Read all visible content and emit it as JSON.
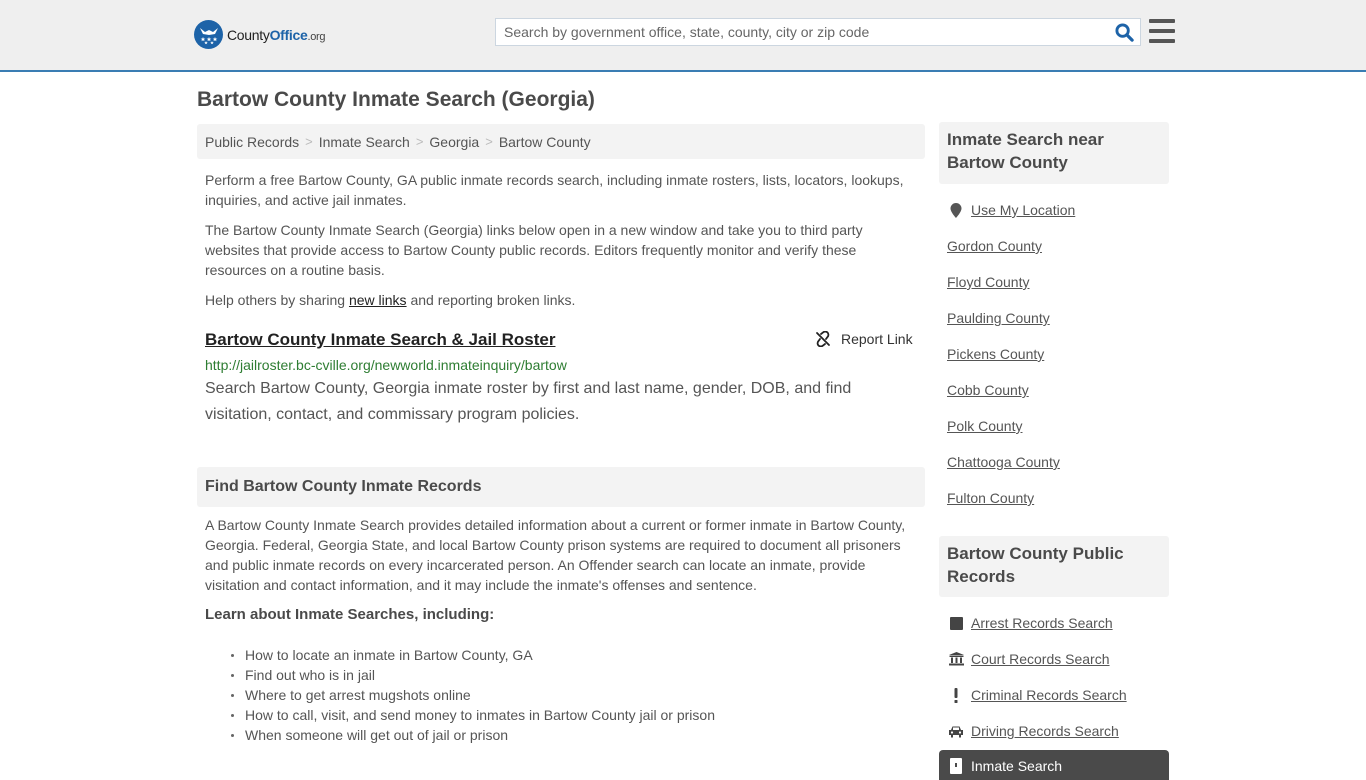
{
  "header": {
    "logo": {
      "name_part1": "County",
      "name_part2": "Office",
      "tld": ".org"
    },
    "search": {
      "placeholder": "Search by government office, state, county, city or zip code",
      "value": ""
    },
    "icons": {
      "search": "search-icon",
      "menu": "hamburger-menu-icon"
    }
  },
  "page": {
    "title": "Bartow County Inmate Search (Georgia)",
    "breadcrumb": [
      {
        "label": "Public Records"
      },
      {
        "label": "Inmate Search"
      },
      {
        "label": "Georgia"
      },
      {
        "label": "Bartow County"
      }
    ],
    "breadcrumb_separator": ">",
    "intro": "Perform a free Bartow County, GA public inmate records search, including inmate rosters, lists, locators, lookups, inquiries, and active jail inmates.",
    "disclaimer": "The Bartow County Inmate Search (Georgia) links below open in a new window and take you to third party websites that provide access to Bartow County public records. Editors frequently monitor and verify these resources on a routine basis.",
    "help": {
      "before": "Help others by sharing ",
      "link": "new links",
      "after": " and reporting broken links."
    }
  },
  "results": [
    {
      "title": "Bartow County Inmate Search & Jail Roster",
      "url": "http://jailroster.bc-cville.org/newworld.inmateinquiry/bartow",
      "description": "Search Bartow County, Georgia inmate roster by first and last name, gender, DOB, and find visitation, contact, and commissary program policies.",
      "report_label": "Report Link",
      "report_icon": "broken-link-icon"
    }
  ],
  "find_section": {
    "heading": "Find Bartow County Inmate Records",
    "body": "A Bartow County Inmate Search provides detailed information about a current or former inmate in Bartow County, Georgia. Federal, Georgia State, and local Bartow County prison systems are required to document all prisoners and public inmate records on every incarcerated person. An Offender search can locate an inmate, provide visitation and contact information, and it may include the inmate's offenses and sentence.",
    "learn_heading": "Learn about Inmate Searches, including:",
    "learn_items": [
      "How to locate an inmate in Bartow County, GA",
      "Find out who is in jail",
      "Where to get arrest mugshots online",
      "How to call, visit, and send money to inmates in Bartow County jail or prison",
      "When someone will get out of jail or prison"
    ]
  },
  "sidebar": {
    "nearby": {
      "heading": "Inmate Search near Bartow County",
      "use_location": {
        "label": "Use My Location",
        "icon": "map-pin-icon"
      },
      "counties": [
        "Gordon County",
        "Floyd County",
        "Paulding County",
        "Pickens County",
        "Cobb County",
        "Polk County",
        "Chattooga County",
        "Fulton County"
      ]
    },
    "public_records": {
      "heading": "Bartow County Public Records",
      "items": [
        {
          "label": "Arrest Records Search",
          "icon": "square-icon"
        },
        {
          "label": "Court Records Search",
          "icon": "courthouse-icon"
        },
        {
          "label": "Criminal Records Search",
          "icon": "exclamation-icon"
        },
        {
          "label": "Driving Records Search",
          "icon": "car-icon"
        },
        {
          "label": "Inmate Search",
          "icon": "jail-door-icon",
          "active": true
        }
      ]
    }
  },
  "colors": {
    "brand_blue": "#1d63a8",
    "header_border": "#3a7db3",
    "url_green": "#2e7d32",
    "active_item_bg": "#4a4a4a",
    "panel_bg": "#f3f3f3"
  }
}
